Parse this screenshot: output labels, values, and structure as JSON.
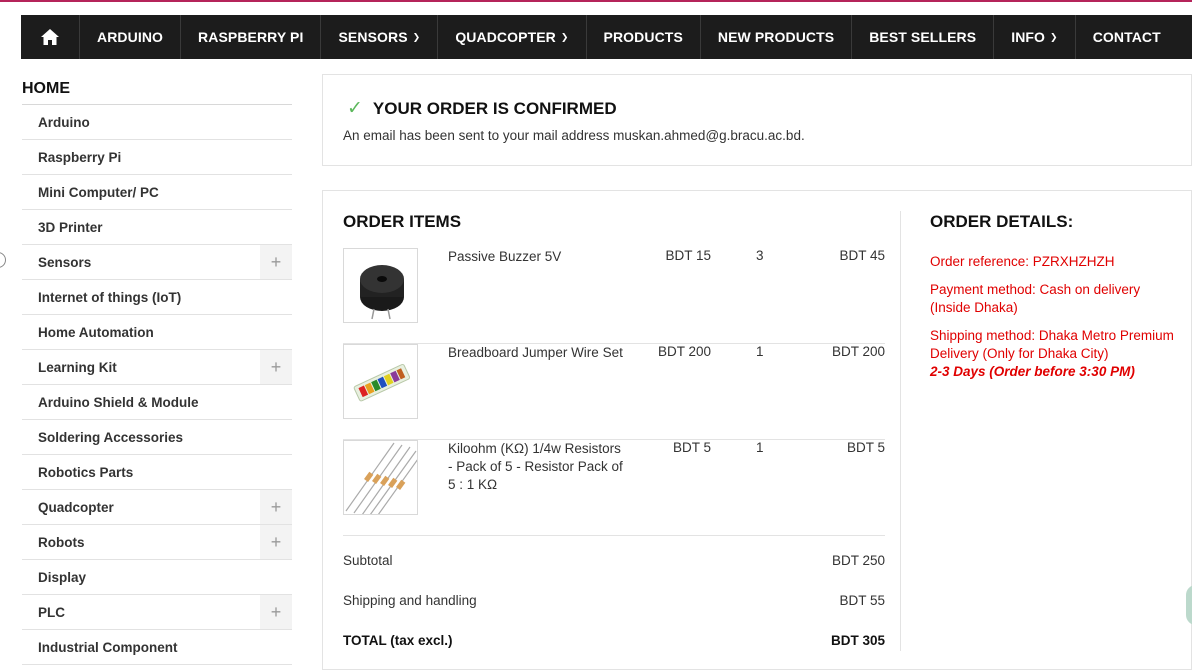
{
  "nav": {
    "items": [
      {
        "label": "ARDUINO",
        "chevron": false
      },
      {
        "label": "RASPBERRY PI",
        "chevron": false
      },
      {
        "label": "SENSORS",
        "chevron": true
      },
      {
        "label": "QUADCOPTER",
        "chevron": true
      },
      {
        "label": "PRODUCTS",
        "chevron": false
      },
      {
        "label": "NEW PRODUCTS",
        "chevron": false
      },
      {
        "label": "BEST SELLERS",
        "chevron": false
      },
      {
        "label": "INFO",
        "chevron": true
      },
      {
        "label": "CONTACT",
        "chevron": false
      }
    ]
  },
  "sidebar": {
    "title": "HOME",
    "items": [
      {
        "label": "Arduino",
        "expandable": false
      },
      {
        "label": "Raspberry Pi",
        "expandable": false
      },
      {
        "label": "Mini Computer/ PC",
        "expandable": false
      },
      {
        "label": "3D Printer",
        "expandable": false
      },
      {
        "label": "Sensors",
        "expandable": true
      },
      {
        "label": "Internet of things (IoT)",
        "expandable": false
      },
      {
        "label": "Home Automation",
        "expandable": false
      },
      {
        "label": "Learning Kit",
        "expandable": true
      },
      {
        "label": "Arduino Shield & Module",
        "expandable": false
      },
      {
        "label": "Soldering Accessories",
        "expandable": false
      },
      {
        "label": "Robotics Parts",
        "expandable": false
      },
      {
        "label": "Quadcopter",
        "expandable": true
      },
      {
        "label": "Robots",
        "expandable": true
      },
      {
        "label": "Display",
        "expandable": false
      },
      {
        "label": "PLC",
        "expandable": true
      },
      {
        "label": "Industrial Component",
        "expandable": false
      }
    ]
  },
  "confirmation": {
    "title": "YOUR ORDER IS CONFIRMED",
    "message": "An email has been sent to your mail address muskan.ahmed@g.bracu.ac.bd."
  },
  "order_items": {
    "title": "ORDER ITEMS",
    "items": [
      {
        "name": "Passive Buzzer 5V",
        "price": "BDT 15",
        "qty": "3",
        "total": "BDT 45"
      },
      {
        "name": "Breadboard Jumper Wire Set",
        "price": "BDT 200",
        "qty": "1",
        "total": "BDT 200"
      },
      {
        "name": "Kiloohm (KΩ) 1/4w Resistors - Pack of 5 - Resistor Pack of 5 : 1 KΩ",
        "price": "BDT 5",
        "qty": "1",
        "total": "BDT 5"
      }
    ],
    "subtotal_label": "Subtotal",
    "subtotal": "BDT 250",
    "shipping_label": "Shipping and handling",
    "shipping": "BDT 55",
    "total_label": "TOTAL (tax excl.)",
    "total": "BDT 305"
  },
  "order_details": {
    "title": "ORDER DETAILS:",
    "reference": "Order reference: PZRXHZHZH",
    "payment": "Payment method: Cash on delivery (Inside Dhaka)",
    "shipping": "Shipping method: Dhaka Metro Premium Delivery (Only for Dhaka City)",
    "eta": "2-3 Days (Order before 3:30 PM)"
  },
  "colors": {
    "navbar": "#1c1c1c",
    "accent_line": "#b5245a",
    "details_text": "#e00000",
    "check": "#5cb85c"
  }
}
